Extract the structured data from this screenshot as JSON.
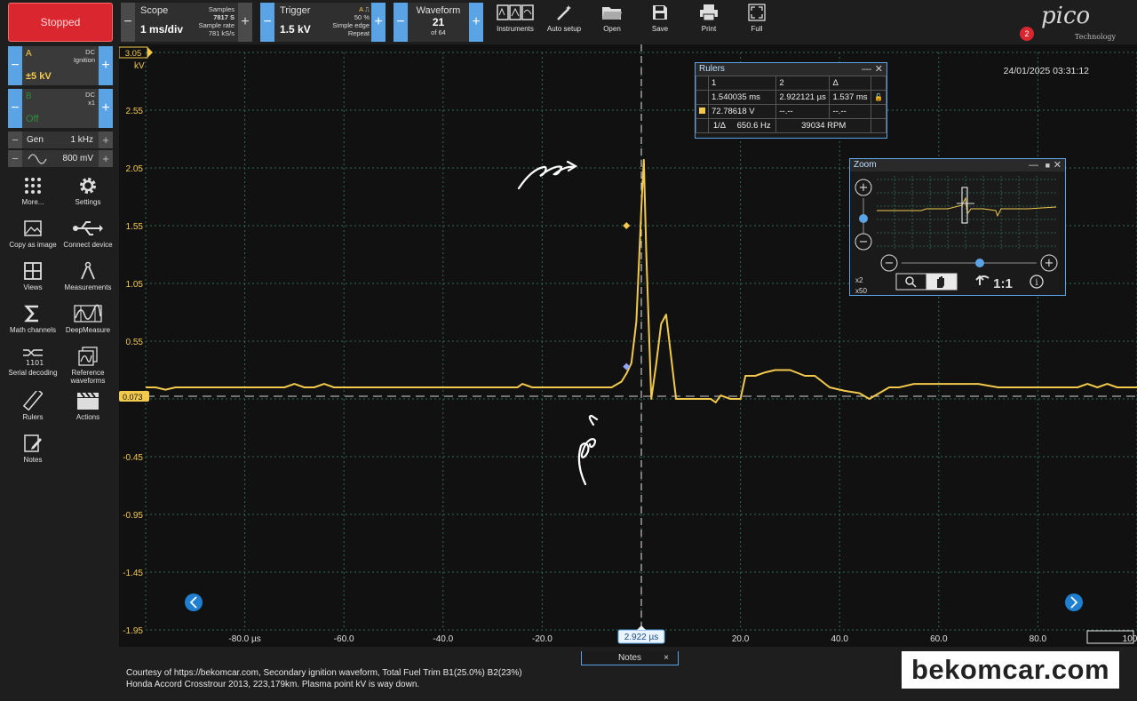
{
  "toolbar": {
    "run_state": "Stopped",
    "scope": {
      "label": "Scope",
      "value": "1 ms/div",
      "samples_label": "Samples",
      "samples": "7817 S",
      "rate_label": "Sample rate",
      "rate": "781 kS/s"
    },
    "trigger": {
      "label": "Trigger",
      "value": "1.5 kV",
      "channel": "A",
      "level": "50 %",
      "type": "Simple edge",
      "mode": "Repeat"
    },
    "waveform": {
      "label": "Waveform",
      "number": "21",
      "of": "of 64"
    },
    "buttons": [
      {
        "label": "Instruments",
        "icon": "instruments-icon"
      },
      {
        "label": "Auto setup",
        "icon": "wand-icon"
      },
      {
        "label": "Open",
        "icon": "folder-icon"
      },
      {
        "label": "Save",
        "icon": "floppy-icon"
      },
      {
        "label": "Print",
        "icon": "printer-icon"
      },
      {
        "label": "Full",
        "icon": "fullscreen-icon"
      }
    ],
    "notification_count": "2",
    "logo": "pico",
    "logo_sub": "Technology"
  },
  "channels": {
    "a": {
      "name": "A",
      "coupling": "DC",
      "probe": "Ignition",
      "range": "±5 kV",
      "color": "#f2c94c"
    },
    "b": {
      "name": "B",
      "coupling": "DC",
      "probe": "x1",
      "range": "Off",
      "color": "#2e8b3e"
    }
  },
  "generator": {
    "label": "Gen",
    "freq": "1 kHz",
    "amplitude": "800 mV"
  },
  "tools": [
    {
      "label": "More...",
      "icon": "dots-grid-icon"
    },
    {
      "label": "Settings",
      "icon": "gear-icon"
    },
    {
      "label": "Copy as image",
      "icon": "image-icon"
    },
    {
      "label": "Connect device",
      "icon": "usb-icon"
    },
    {
      "label": "Views",
      "icon": "views-grid-icon"
    },
    {
      "label": "Measurements",
      "icon": "compass-icon"
    },
    {
      "label": "Math channels",
      "icon": "sigma-icon"
    },
    {
      "label": "DeepMeasure",
      "icon": "deepmeasure-icon"
    },
    {
      "label": "Serial decoding",
      "icon": "serial-icon"
    },
    {
      "label": "Reference waveforms",
      "icon": "reference-icon"
    },
    {
      "label": "Rulers",
      "icon": "ruler-icon"
    },
    {
      "label": "Actions",
      "icon": "clapper-icon"
    },
    {
      "label": "Notes",
      "icon": "notes-icon"
    }
  ],
  "timestamp": "24/01/2025 03:31:12",
  "rulers_window": {
    "title": "Rulers",
    "headers": [
      "1",
      "2",
      "Δ"
    ],
    "time_row": [
      "1.540035 ms",
      "2.922121 µs",
      "1.537 ms"
    ],
    "volt_row": [
      "72.78618 V",
      "--.--",
      "--.--"
    ],
    "freq_label": "1/Δ",
    "freq": "650.6 Hz",
    "rpm": "39034 RPM"
  },
  "zoom_window": {
    "title": "Zoom",
    "x_zoom": "x2",
    "y_zoom": "x50",
    "reset": "1:1"
  },
  "ruler_readout": "2.922 µs",
  "ruler_level": "0.073",
  "nav": {
    "left": "scroll-left",
    "right": "scroll-right"
  },
  "notes": {
    "tab_label": "Notes",
    "close": "×",
    "line1": "Courtesy of https://bekomcar.com, Secondary ignition waveform, Total Fuel Trim B1(25.0%) B2(23%)",
    "line2": "Honda Accord Crosstrour 2013, 223,179km. Plasma point kV is way down."
  },
  "watermark": "bekomcar.com",
  "chart_data": {
    "type": "line",
    "title": "",
    "xlabel": "µs",
    "ylabel": "kV",
    "xlim": [
      -100,
      100
    ],
    "ylim": [
      -1.95,
      3.05
    ],
    "grid": true,
    "y_ticks": [
      "3.05",
      "2.55",
      "2.05",
      "1.55",
      "1.05",
      "0.55",
      "0.05",
      "-0.45",
      "-0.95",
      "-1.45",
      "-1.95"
    ],
    "x_ticks": [
      "-80.0 µs",
      "-60.0",
      "-40.0",
      "-20.0",
      "0.0",
      "20.0",
      "40.0",
      "60.0",
      "80.0",
      "100"
    ],
    "x_tick_values": [
      -80,
      -60,
      -40,
      -20,
      0,
      20,
      40,
      60,
      80,
      100
    ],
    "series": [
      {
        "color": "#f2c94c",
        "x": [
          -100,
          -98,
          -96,
          -94,
          -92,
          -88,
          -84,
          -80,
          -76,
          -72,
          -70,
          -68,
          -66,
          -64,
          -62,
          -60,
          -56,
          -52,
          -48,
          -44,
          -40,
          -36,
          -32,
          -28,
          -25,
          -24,
          -22,
          -18,
          -14,
          -10,
          -6,
          -4,
          -3,
          -2,
          -1,
          0,
          0.5,
          1,
          2,
          3,
          4,
          5,
          7,
          8,
          10,
          12,
          14,
          15,
          16,
          18,
          20,
          21,
          23,
          25,
          27,
          30,
          33,
          35,
          38,
          41,
          44,
          46,
          48,
          50,
          52,
          55,
          58,
          60,
          64,
          68,
          72,
          76,
          80,
          84,
          88,
          90,
          92,
          94,
          96,
          98,
          100
        ],
        "y": [
          0.15,
          0.15,
          0.13,
          0.15,
          0.15,
          0.15,
          0.15,
          0.15,
          0.15,
          0.15,
          0.18,
          0.15,
          0.15,
          0.18,
          0.15,
          0.15,
          0.15,
          0.15,
          0.15,
          0.15,
          0.15,
          0.15,
          0.15,
          0.15,
          0.15,
          0.18,
          0.15,
          0.15,
          0.15,
          0.15,
          0.15,
          0.2,
          0.27,
          0.36,
          0.72,
          1.7,
          2.12,
          1.3,
          0.05,
          0.35,
          0.7,
          0.78,
          0.05,
          0.05,
          0.05,
          0.05,
          0.05,
          0.02,
          0.08,
          0.05,
          0.05,
          0.25,
          0.25,
          0.28,
          0.3,
          0.3,
          0.25,
          0.25,
          0.15,
          0.12,
          0.1,
          0.05,
          0.1,
          0.15,
          0.15,
          0.18,
          0.18,
          0.18,
          0.18,
          0.18,
          0.15,
          0.15,
          0.15,
          0.15,
          0.15,
          0.18,
          0.15,
          0.18,
          0.15,
          0.15,
          0.15
        ]
      }
    ],
    "ruler_time": 0,
    "ruler_voltage": 0.073
  }
}
